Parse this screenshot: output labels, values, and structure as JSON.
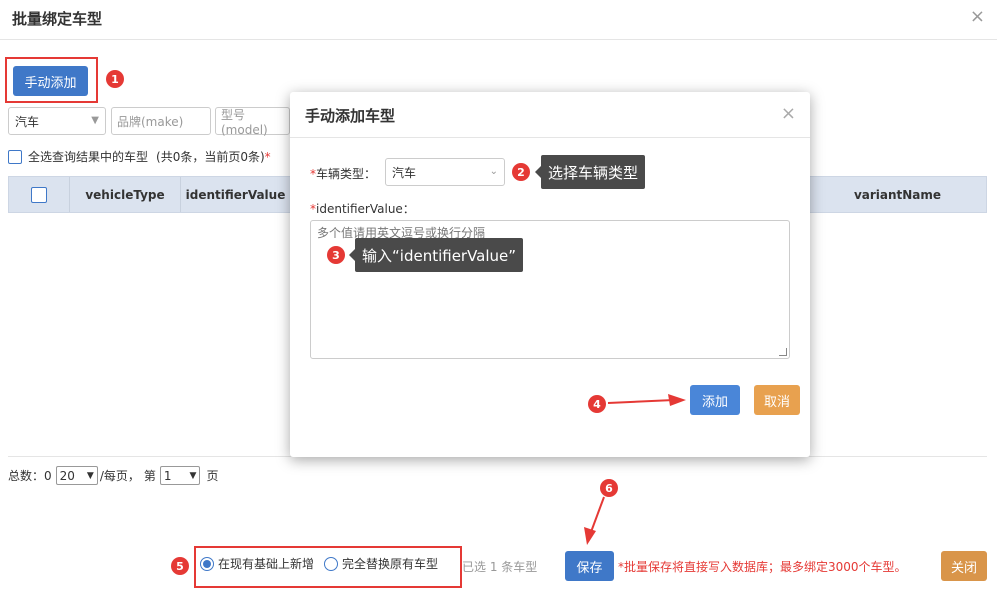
{
  "outer": {
    "title": "批量绑定车型",
    "close_glyph": "×",
    "manual_add_label": "手动添加",
    "vehicle_select": "汽车",
    "make_placeholder": "品牌(make)",
    "model_placeholder": "型号(model)",
    "select_all_label": "全选查询结果中的车型",
    "count_text": "(共0条，当前页0条)",
    "required_mark": "*",
    "table_headers": [
      "vehicleType",
      "identifierValue",
      "variantName"
    ],
    "pager": {
      "total_label": "总数：0",
      "page_size": "20",
      "per_page_label": "/每页，",
      "page_prefix": "第",
      "page_number": "1",
      "page_suffix": "页"
    },
    "radios": [
      "在现有基础上新增",
      "完全替换原有车型"
    ],
    "selected_text": "已选 1 条车型",
    "save_label": "保存",
    "warning": "*批量保存将直接写入数据库；最多绑定3000个车型。",
    "close_label": "关闭"
  },
  "modal": {
    "title": "手动添加车型",
    "close_glyph": "×",
    "vehicle_type_label": "车辆类型：",
    "vehicle_type_value": "汽车",
    "identifier_label": "identifierValue：",
    "required_mark": "*",
    "textarea_placeholder": "多个值请用英文逗号或换行分隔",
    "add_label": "添加",
    "cancel_label": "取消"
  },
  "annotations": {
    "badges": [
      "1",
      "2",
      "3",
      "4",
      "5",
      "6"
    ],
    "tooltip_vehicle": "选择车辆类型",
    "tooltip_identifier": "输入“identifierValue”"
  },
  "colors": {
    "primary": "#3f78c8",
    "warning_orange": "#e8a14f",
    "annotation_red": "#e53935"
  }
}
